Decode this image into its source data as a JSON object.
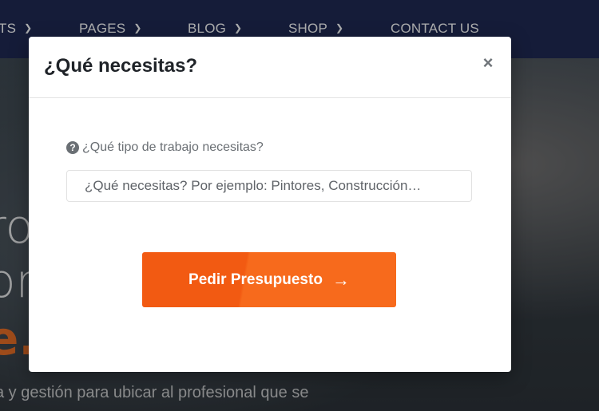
{
  "nav": {
    "items": [
      {
        "label": "TS"
      },
      {
        "label": "PAGES"
      },
      {
        "label": "BLOG"
      },
      {
        "label": "SHOP"
      },
      {
        "label": "CONTACT US"
      }
    ]
  },
  "hero": {
    "line1": "ro",
    "line2": "or",
    "line3": "e.",
    "subtitle": "a y gestión para ubicar al profesional que se"
  },
  "modal": {
    "title": "¿Qué necesitas?",
    "close_symbol": "×",
    "field_label": "¿Qué tipo de trabajo necesitas?",
    "help_symbol": "?",
    "search_placeholder": "¿Qué necesitas? Por ejemplo: Pintores, Construcción…",
    "submit_label": "Pedir Presupuesto",
    "submit_arrow": "→"
  },
  "colors": {
    "nav_bg": "#16204a",
    "accent_orange": "#f25a12"
  }
}
